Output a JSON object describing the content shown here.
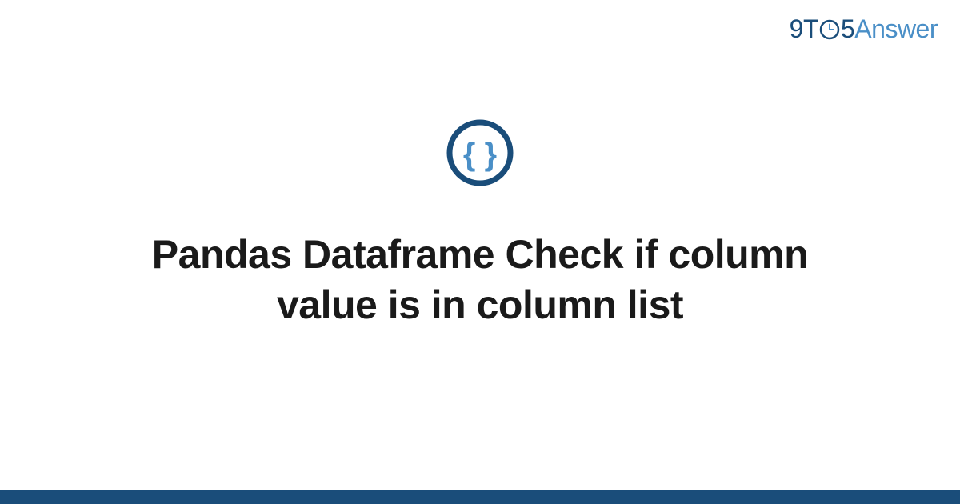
{
  "header": {
    "logo": {
      "part1": "9T",
      "part2": "5",
      "part3": "Answer"
    }
  },
  "main": {
    "title": "Pandas Dataframe Check if column value is in column list"
  },
  "colors": {
    "primary": "#1a4d7a",
    "accent": "#4a8fc7"
  }
}
